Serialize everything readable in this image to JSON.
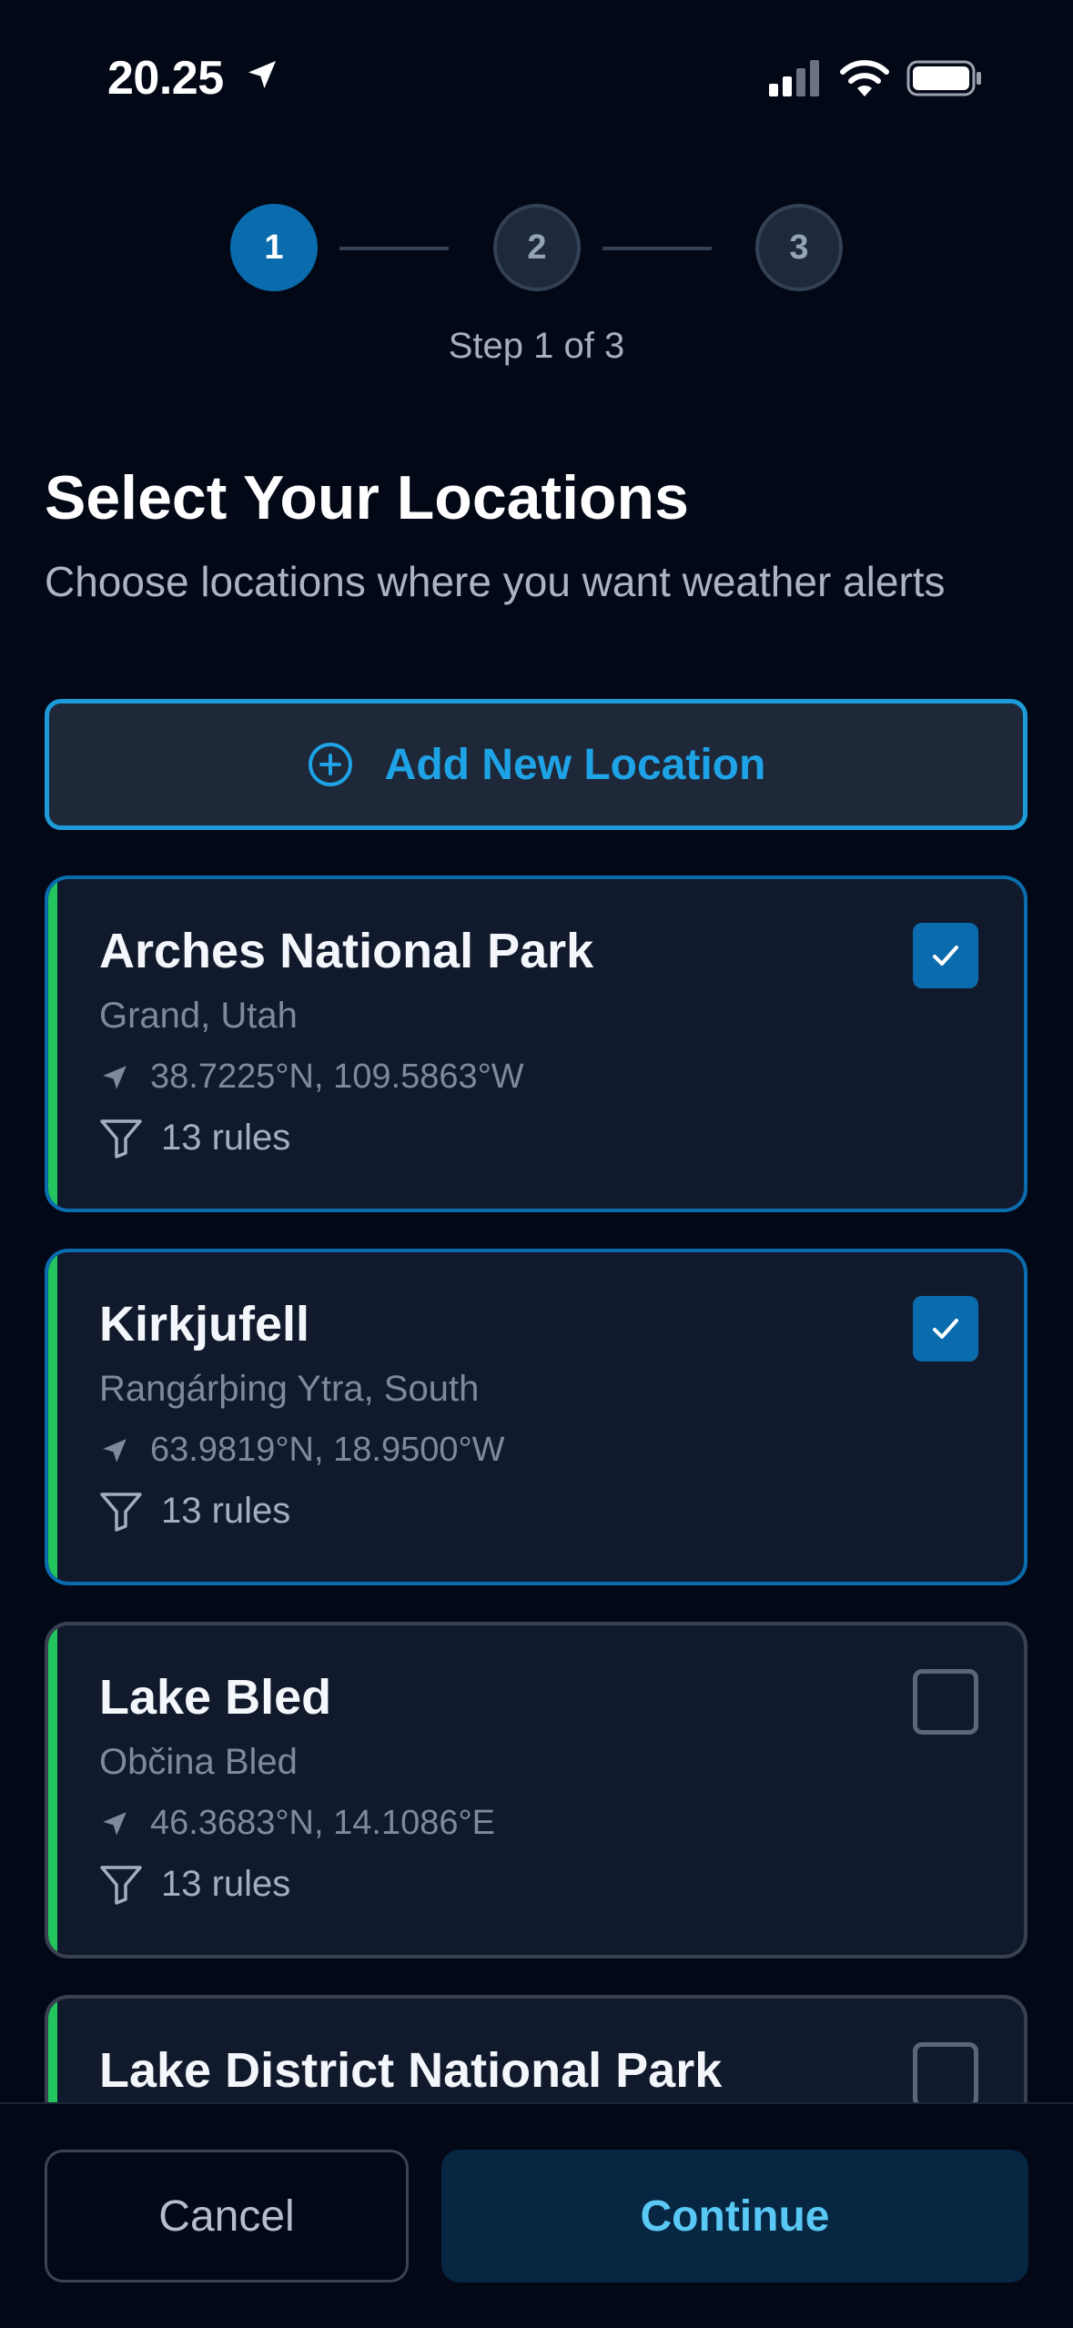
{
  "status_bar": {
    "time": "20.25"
  },
  "stepper": {
    "steps": [
      "1",
      "2",
      "3"
    ],
    "current": 1,
    "caption": "Step 1 of 3"
  },
  "header": {
    "title": "Select Your Locations",
    "subtitle": "Choose locations where you want weather alerts"
  },
  "add_button": {
    "label": "Add New Location",
    "icon": "plus-circle-icon"
  },
  "locations": [
    {
      "name": "Arches National Park",
      "region": "Grand, Utah",
      "coords": "38.7225°N, 109.5863°W",
      "rules": "13 rules",
      "selected": true
    },
    {
      "name": "Kirkjufell",
      "region": "Rangárþing Ytra, South",
      "coords": "63.9819°N, 18.9500°W",
      "rules": "13 rules",
      "selected": true
    },
    {
      "name": "Lake Bled",
      "region": "Občina Bled",
      "coords": "46.3683°N, 14.1086°E",
      "rules": "13 rules",
      "selected": false
    },
    {
      "name": "Lake District National Park",
      "selected": false
    }
  ],
  "footer": {
    "cancel_label": "Cancel",
    "continue_label": "Continue"
  },
  "colors": {
    "background": "#030817",
    "accent_blue": "#0b6cad",
    "link_blue": "#1ea3e6",
    "card_accent_green": "#22c55e",
    "continue_text": "#5ac8f5"
  }
}
